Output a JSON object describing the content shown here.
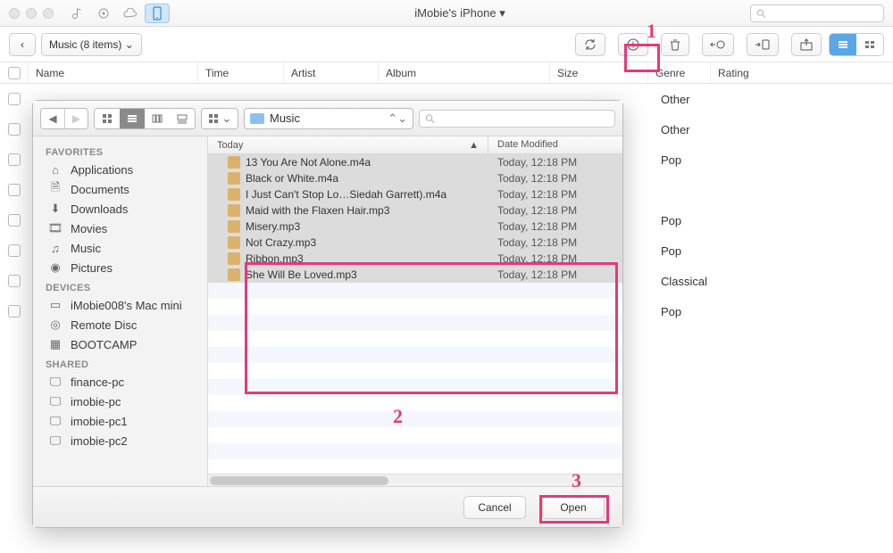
{
  "window": {
    "title": "iMobie's iPhone",
    "title_suffix": " ▾"
  },
  "toolbar": {
    "back_icon": "‹",
    "crumb": "Music (8 items)",
    "search_placeholder": ""
  },
  "columns": {
    "name": "Name",
    "time": "Time",
    "artist": "Artist",
    "album": "Album",
    "size": "Size",
    "genre": "Genre",
    "rating": "Rating"
  },
  "bg_genres": [
    "Other",
    "Other",
    "Pop",
    "",
    "Pop",
    "Pop",
    "Classical",
    "Pop"
  ],
  "annotations": {
    "one": "1",
    "two": "2",
    "three": "3"
  },
  "dialog": {
    "path_label": "Music",
    "col_today": "Today",
    "col_datemod": "Date Modified",
    "search_placeholder": "",
    "cancel": "Cancel",
    "open": "Open",
    "sidebar": {
      "favorites_hdr": "FAVORITES",
      "devices_hdr": "DEVICES",
      "shared_hdr": "SHARED",
      "favorites": [
        "Applications",
        "Documents",
        "Downloads",
        "Movies",
        "Music",
        "Pictures"
      ],
      "devices": [
        "iMobie008's Mac mini",
        "Remote Disc",
        "BOOTCAMP"
      ],
      "shared": [
        "finance-pc",
        "imobie-pc",
        "imobie-pc1",
        "imobie-pc2"
      ]
    },
    "files": [
      {
        "name": "13 You Are Not Alone.m4a",
        "mod": "Today, 12:18 PM"
      },
      {
        "name": "Black or White.m4a",
        "mod": "Today, 12:18 PM"
      },
      {
        "name": "I Just Can't Stop Lo…Siedah Garrett).m4a",
        "mod": "Today, 12:18 PM"
      },
      {
        "name": "Maid with the Flaxen Hair.mp3",
        "mod": "Today, 12:18 PM"
      },
      {
        "name": "Misery.mp3",
        "mod": "Today, 12:18 PM"
      },
      {
        "name": "Not Crazy.mp3",
        "mod": "Today, 12:18 PM"
      },
      {
        "name": "Ribbon.mp3",
        "mod": "Today, 12:18 PM"
      },
      {
        "name": "She Will Be Loved.mp3",
        "mod": "Today, 12:18 PM"
      }
    ]
  }
}
